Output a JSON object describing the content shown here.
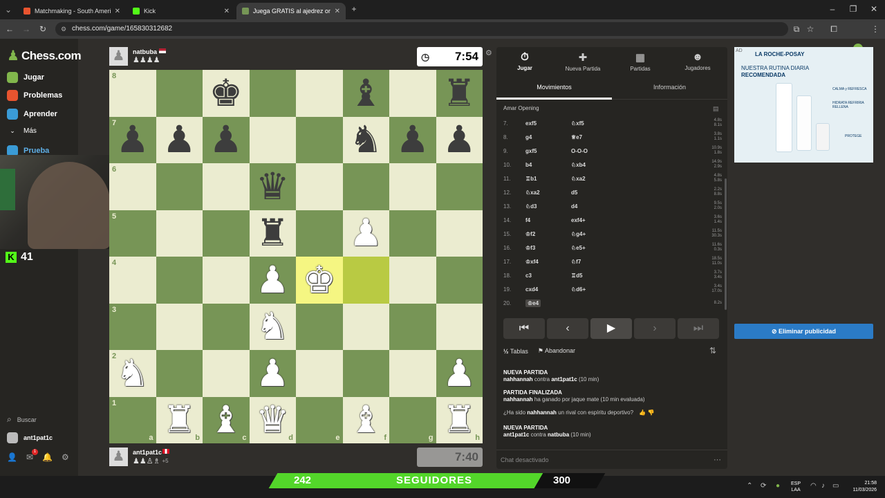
{
  "browser": {
    "tabs": [
      {
        "title": "Matchmaking - South America",
        "color": "#e8542f"
      },
      {
        "title": "Kick",
        "color": "#53fc18"
      },
      {
        "title": "Juega GRATIS al ajedrez online",
        "color": "#769656"
      }
    ],
    "url": "chess.com/game/165830312682"
  },
  "sidebar": {
    "logo": "Chess.com",
    "items": [
      {
        "label": "Jugar",
        "icon": "pawn-icon",
        "color": "#81b64c"
      },
      {
        "label": "Problemas",
        "icon": "puzzle-icon",
        "color": "#e8542f"
      },
      {
        "label": "Aprender",
        "icon": "graduation-icon",
        "color": "#3a9bd6"
      },
      {
        "label": "Más",
        "icon": "chevron-down-icon",
        "color": "#262522"
      },
      {
        "label": "Prueba",
        "icon": "gift-icon",
        "color": "#3a9bd6"
      }
    ],
    "search": "Buscar",
    "user": "ant1pat1c",
    "mail_badge": "1"
  },
  "kick": {
    "count": "41"
  },
  "top_player": {
    "name": "natbuba",
    "captured": "♟♟♟♟",
    "clock": "7:54"
  },
  "bottom_player": {
    "name": "ant1pat1c",
    "captured": "♟♟♙♗",
    "advantage": "+5",
    "clock": "7:40"
  },
  "board": {
    "ranks": [
      "8",
      "7",
      "6",
      "5",
      "4",
      "3",
      "2",
      "1"
    ],
    "files": [
      "a",
      "b",
      "c",
      "d",
      "e",
      "f",
      "g",
      "h"
    ],
    "pieces": [
      {
        "sq": "c8",
        "p": "♚",
        "c": "b"
      },
      {
        "sq": "f8",
        "p": "♝",
        "c": "b"
      },
      {
        "sq": "h8",
        "p": "♜",
        "c": "b"
      },
      {
        "sq": "a7",
        "p": "♟",
        "c": "b"
      },
      {
        "sq": "b7",
        "p": "♟",
        "c": "b"
      },
      {
        "sq": "c7",
        "p": "♟",
        "c": "b"
      },
      {
        "sq": "f7",
        "p": "♞",
        "c": "b"
      },
      {
        "sq": "g7",
        "p": "♟",
        "c": "b"
      },
      {
        "sq": "h7",
        "p": "♟",
        "c": "b"
      },
      {
        "sq": "d6",
        "p": "♛",
        "c": "b"
      },
      {
        "sq": "d5",
        "p": "♜",
        "c": "b"
      },
      {
        "sq": "f5",
        "p": "♟",
        "c": "w"
      },
      {
        "sq": "d4",
        "p": "♟",
        "c": "w"
      },
      {
        "sq": "e4",
        "p": "♚",
        "c": "w"
      },
      {
        "sq": "d3",
        "p": "♞",
        "c": "w"
      },
      {
        "sq": "a2",
        "p": "♞",
        "c": "w"
      },
      {
        "sq": "d2",
        "p": "♟",
        "c": "w"
      },
      {
        "sq": "h2",
        "p": "♟",
        "c": "w"
      },
      {
        "sq": "b1",
        "p": "♜",
        "c": "w"
      },
      {
        "sq": "c1",
        "p": "♝",
        "c": "w"
      },
      {
        "sq": "d1",
        "p": "♛",
        "c": "w"
      },
      {
        "sq": "f1",
        "p": "♝",
        "c": "w"
      },
      {
        "sq": "h1",
        "p": "♜",
        "c": "w"
      }
    ],
    "highlight": [
      "e4",
      "f4"
    ]
  },
  "panel": {
    "tabs": [
      {
        "label": "Jugar",
        "icon": "stopwatch-icon",
        "glyph": "⏱"
      },
      {
        "label": "Nueva Partida",
        "icon": "plus-icon",
        "glyph": "✚"
      },
      {
        "label": "Partidas",
        "icon": "board-icon",
        "glyph": "▦"
      },
      {
        "label": "Jugadores",
        "icon": "players-icon",
        "glyph": "👥"
      }
    ],
    "subtabs": [
      "Movimientos",
      "Información"
    ],
    "opening": "Amar Opening",
    "moves": [
      {
        "n": "7.",
        "w": "exf5",
        "b": "♘xf5",
        "tw": "4.8s",
        "tb": "8.1s"
      },
      {
        "n": "8.",
        "w": "g4",
        "b": "♕e7",
        "tw": "3.8s",
        "tb": "1.1s"
      },
      {
        "n": "9.",
        "w": "gxf5",
        "b": "O-O-O",
        "tw": "10.9s",
        "tb": "1.8s"
      },
      {
        "n": "10.",
        "w": "b4",
        "b": "♘xb4",
        "tw": "14.9s",
        "tb": "2.9s"
      },
      {
        "n": "11.",
        "w": "♖b1",
        "b": "♘xa2",
        "tw": "4.8s",
        "tb": "5.8s"
      },
      {
        "n": "12.",
        "w": "♘xa2",
        "b": "d5",
        "tw": "2.2s",
        "tb": "8.8s"
      },
      {
        "n": "13.",
        "w": "♘d3",
        "b": "d4",
        "tw": "9.5s",
        "tb": "2.0s"
      },
      {
        "n": "14.",
        "w": "f4",
        "b": "exf4+",
        "tw": "3.6s",
        "tb": "1.4s"
      },
      {
        "n": "15.",
        "w": "♔f2",
        "b": "♘g4+",
        "tw": "11.5s",
        "tb": "30.3s"
      },
      {
        "n": "16.",
        "w": "♔f3",
        "b": "♘e5+",
        "tw": "11.6s",
        "tb": "0.3s"
      },
      {
        "n": "17.",
        "w": "♔xf4",
        "b": "♘f7",
        "tw": "18.5s",
        "tb": "11.0s"
      },
      {
        "n": "18.",
        "w": "c3",
        "b": "♖d5",
        "tw": "3.7s",
        "tb": "3.4s"
      },
      {
        "n": "19.",
        "w": "cxd4",
        "b": "♘d6+",
        "tw": "3.4s",
        "tb": "17.0s"
      },
      {
        "n": "20.",
        "w": "♔e4",
        "b": "",
        "tw": "8.2s",
        "tb": ""
      }
    ],
    "draw": "Tablas",
    "draw_icon": "½",
    "resign": "Abandonar",
    "chat": [
      {
        "head": "NUEVA PARTIDA",
        "a": "nahhannah",
        "mid": " contra ",
        "b": "ant1pat1c",
        "tail": " (10 min)"
      },
      {
        "head": "PARTIDA FINALIZADA",
        "a": "nahhannah",
        "mid": " ha ganado por jaque mate (10 min evaluada)",
        "b": "",
        "tail": ""
      },
      {
        "head": "",
        "a": "¿Ha sido ",
        "mid": "nahhannah",
        "b": " un rival con espíritu deportivo?",
        "tail": ""
      },
      {
        "head": "NUEVA PARTIDA",
        "a": "ant1pat1c",
        "mid": " contra ",
        "b": "natbuba",
        "tail": " (10 min)"
      }
    ],
    "chat_disabled": "Chat desactivado"
  },
  "ad": {
    "tag": "AD",
    "brand": "LA ROCHE-POSAY",
    "headline1": "NUESTRA RUTINA DIARIA",
    "headline2": "RECOMENDADA",
    "steps": [
      "CALMA y REFRESCA",
      "HIDRATA REFRIRIA RELLENA",
      "PROTEGE"
    ],
    "remove_btn": "Eliminar publicidad"
  },
  "banner": {
    "left": "242",
    "mid": "SEGUIDORES",
    "right": "300"
  },
  "taskbar": {
    "lang1": "ESP",
    "lang2": "LAA",
    "time": "21:58",
    "date": "11/03/2026"
  }
}
